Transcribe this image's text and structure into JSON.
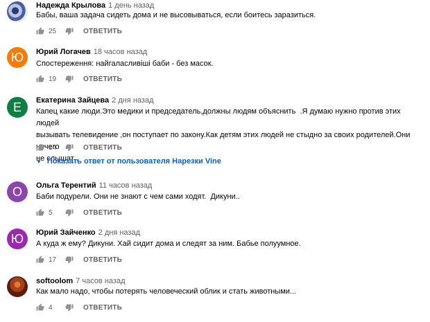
{
  "action_reply_label": "ОТВЕТИТЬ",
  "comments": [
    {
      "author": "Надежда Крылова",
      "time": "1 день назад",
      "text": "Бабы, ваша задача сидеть дома и не высовываться, если боитесь заразиться.",
      "likes": "25",
      "avatar": {
        "type": "image",
        "color": "#7b8cc0"
      }
    },
    {
      "author": "Юрий Логачев",
      "time": "18 часов назад",
      "text": "Спостереження: найгаласливіші баби - без масок.",
      "likes": "19",
      "avatar": {
        "type": "letter",
        "letter": "Ю",
        "color": "#f57c00"
      }
    },
    {
      "author": "Екатерина Зайцева",
      "time": "2 дня назад",
      "text": "Капец какие люди.Это медики и председатель,должны людям объяснить  .Я думаю нужно против этих людей\nвызывать телевидение ,он поступает по закону.Как детям этих людей не стыдно за своих родителей.Они нечего\nне слышат .",
      "likes": "14",
      "avatar": {
        "type": "letter",
        "letter": "Е",
        "color": "#0b8043"
      },
      "replies_label": "Показать ответ от пользователя Нарезки Vine"
    },
    {
      "author": "Ольга Терентий",
      "time": "11 часов назад",
      "text": "Баби подурели. Они не знают с чем сами ходят.  Дикуни..",
      "likes": "5",
      "avatar": {
        "type": "letter",
        "letter": "О",
        "color": "#8e44ad"
      }
    },
    {
      "author": "Юрий Зайченко",
      "time": "2 дня назад",
      "text": "А куда ж ему? Дикуни. Хай сидит дома и следят за ним. Бабье полуумное.",
      "likes": "17",
      "avatar": {
        "type": "letter",
        "letter": "Ю",
        "color": "#9c27b0"
      }
    },
    {
      "author": "softoolom",
      "time": "7 часов назад",
      "text": "Как мало надо, чтобы потерять человеческий облик и стать животными...",
      "likes": "4",
      "avatar": {
        "type": "image",
        "color": "#7a2a10"
      }
    }
  ]
}
